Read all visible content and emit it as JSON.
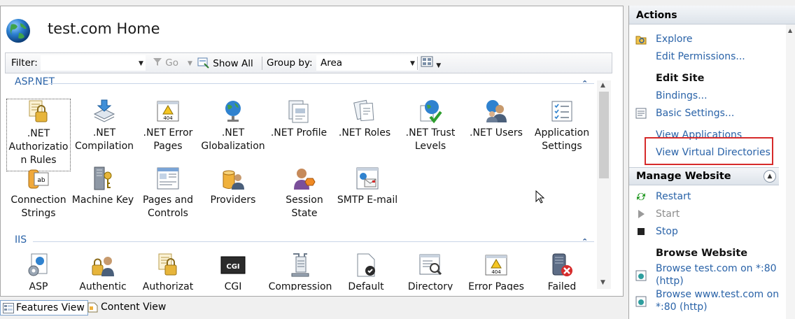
{
  "header": {
    "title": "test.com Home"
  },
  "filterbar": {
    "filter_label": "Filter:",
    "go_label": "Go",
    "show_all_label": "Show All",
    "group_by_label": "Group by:",
    "group_by_value": "Area"
  },
  "groups": {
    "aspnet": {
      "label": "ASP.NET",
      "items": [
        {
          "label": ".NET Authorizatio n Rules",
          "icon": "lock-document-icon"
        },
        {
          "label": ".NET Compilation",
          "icon": "compile-stack-icon"
        },
        {
          "label": ".NET Error Pages",
          "icon": "error-page-404-icon"
        },
        {
          "label": ".NET Globalization",
          "icon": "globe-icon"
        },
        {
          "label": ".NET Profile",
          "icon": "profile-pages-icon"
        },
        {
          "label": ".NET Roles",
          "icon": "roles-pages-icon"
        },
        {
          "label": ".NET Trust Levels",
          "icon": "globe-check-icon"
        },
        {
          "label": ".NET Users",
          "icon": "users-icon"
        },
        {
          "label": "Application Settings",
          "icon": "settings-list-icon"
        },
        {
          "label": "Connection Strings",
          "icon": "connection-strings-icon"
        },
        {
          "label": "Machine Key",
          "icon": "machine-key-icon"
        },
        {
          "label": "Pages and Controls",
          "icon": "pages-controls-icon"
        },
        {
          "label": "Providers",
          "icon": "providers-icon"
        },
        {
          "label": "Session State",
          "icon": "session-state-icon"
        },
        {
          "label": "SMTP E-mail",
          "icon": "smtp-email-icon"
        }
      ]
    },
    "iis": {
      "label": "IIS",
      "items": [
        {
          "label": "ASP",
          "icon": "asp-icon"
        },
        {
          "label": "Authentic",
          "icon": "authentication-icon"
        },
        {
          "label": "Authorizat",
          "icon": "authorization-icon"
        },
        {
          "label": "CGI",
          "icon": "cgi-icon"
        },
        {
          "label": "Compression",
          "icon": "compression-icon"
        },
        {
          "label": "Default",
          "icon": "default-document-icon"
        },
        {
          "label": "Directory",
          "icon": "directory-browsing-icon"
        },
        {
          "label": "Error Pages",
          "icon": "error-pages-icon"
        },
        {
          "label": "Failed",
          "icon": "failed-request-icon"
        }
      ]
    }
  },
  "tabs": {
    "features": "Features View",
    "content": "Content View"
  },
  "actions": {
    "title": "Actions",
    "explore": "Explore",
    "edit_permissions": "Edit Permissions...",
    "edit_site": "Edit Site",
    "bindings": "Bindings...",
    "basic_settings": "Basic Settings...",
    "view_applications": "View Applications",
    "view_virtual_directories": "View Virtual Directories",
    "manage_website": "Manage Website",
    "restart": "Restart",
    "start": "Start",
    "stop": "Stop",
    "browse_website": "Browse Website",
    "browse1": "Browse test.com on *:80",
    "browse1b": "(http)",
    "browse2": "Browse www.test.com on",
    "browse2b": "*:80 (http)"
  },
  "colors": {
    "link": "#2a63a8",
    "highlight": "#d62b2b",
    "disabled": "#8d8d8d"
  }
}
